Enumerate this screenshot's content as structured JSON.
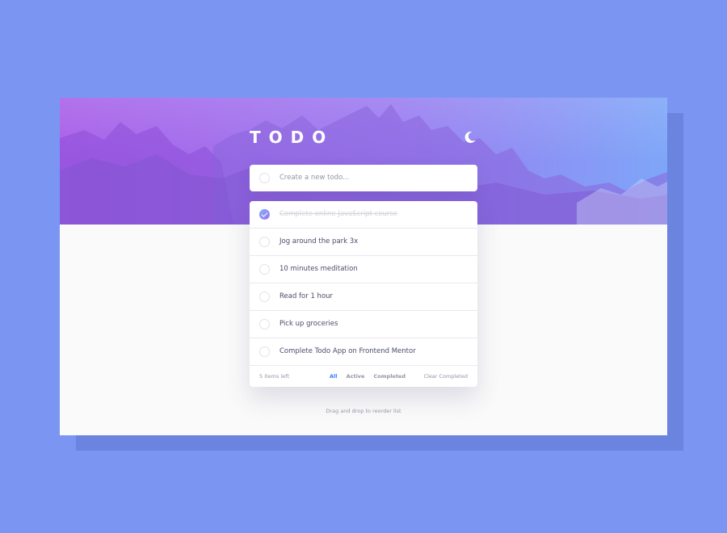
{
  "app": {
    "title": "TODO",
    "theme_toggle_icon": "moon-icon"
  },
  "new_todo": {
    "placeholder": "Create a new todo..."
  },
  "todos": [
    {
      "text": "Complete online JavaScript course",
      "completed": true
    },
    {
      "text": "Jog around the park 3x",
      "completed": false
    },
    {
      "text": "10 minutes meditation",
      "completed": false
    },
    {
      "text": "Read for 1 hour",
      "completed": false
    },
    {
      "text": "Pick up groceries",
      "completed": false
    },
    {
      "text": "Complete Todo App on Frontend Mentor",
      "completed": false
    }
  ],
  "footer": {
    "items_left": "5 items left",
    "filters": [
      "All",
      "Active",
      "Completed"
    ],
    "active_filter": "All",
    "clear_label": "Clear Completed"
  },
  "hint": "Drag and drop to reorder list",
  "colors": {
    "page_background": "#7b96f2",
    "app_background": "#fafafa",
    "accent": "#3a7bfd",
    "check_gradient_start": "#77b3ff",
    "check_gradient_end": "#a670ee",
    "banner_gradient_start": "#a85fe8",
    "banner_gradient_end": "#7ea6f8"
  }
}
